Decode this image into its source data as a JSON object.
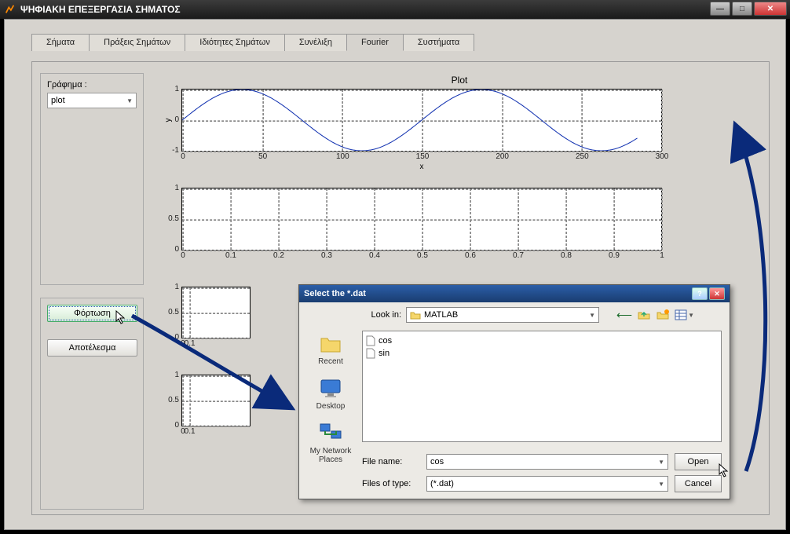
{
  "window": {
    "title": "ΨΗΦΙΑΚΗ ΕΠΕΞΕΡΓΑΣΙΑ ΣΗΜΑΤΟΣ"
  },
  "tabs": [
    {
      "label": "Σήματα",
      "active": false
    },
    {
      "label": "Πράξεις Σημάτων",
      "active": false
    },
    {
      "label": "Ιδιότητες Σημάτων",
      "active": false
    },
    {
      "label": "Συνέλιξη",
      "active": false
    },
    {
      "label": "Fourier",
      "active": true
    },
    {
      "label": "Συστήματα",
      "active": false
    }
  ],
  "sidebar": {
    "graph_label": "Γράφημα :",
    "graph_value": "plot",
    "load_btn": "Φόρτωση",
    "result_btn": "Αποτέλεσμα"
  },
  "chart_data": [
    {
      "type": "line",
      "title": "Plot",
      "xlabel": "x",
      "ylabel": "y",
      "xlim": [
        0,
        300
      ],
      "ylim": [
        -1,
        1
      ],
      "xticks": [
        0,
        50,
        100,
        150,
        200,
        250,
        300
      ],
      "yticks": [
        -1,
        0,
        1
      ],
      "function": "sin(2*pi*x/150)",
      "x": [
        0,
        25,
        50,
        75,
        100,
        125,
        150,
        175,
        200,
        225,
        250,
        275,
        300
      ],
      "y": [
        0,
        0.87,
        0.87,
        0,
        -0.87,
        -0.87,
        0,
        0.87,
        0.87,
        0,
        -0.87,
        -0.87,
        0
      ],
      "note": "Sine wave, period ≈150, amplitude 1. Curve drawn to x≈285."
    },
    {
      "type": "line",
      "title": "",
      "xlim": [
        0,
        1
      ],
      "ylim": [
        0,
        1
      ],
      "xticks": [
        0,
        0.1,
        0.2,
        0.3,
        0.4,
        0.5,
        0.6,
        0.7,
        0.8,
        0.9,
        1
      ],
      "yticks": [
        0,
        0.5,
        1
      ],
      "series": [],
      "note": "Empty axes (full width)."
    },
    {
      "type": "line",
      "xlim": [
        0,
        1
      ],
      "ylim": [
        0,
        1
      ],
      "xticks": [
        0,
        0.1
      ],
      "yticks": [
        0,
        0.5,
        1
      ],
      "series": [],
      "note": "Empty axes, left column (narrow, partially obscured by dialog)."
    },
    {
      "type": "line",
      "xlim": [
        0,
        1
      ],
      "ylim": [
        0,
        1
      ],
      "xticks": [
        0,
        0.1
      ],
      "yticks": [
        0,
        0.5,
        1
      ],
      "series": [],
      "note": "Empty axes, left column bottom (narrow, partially obscured by dialog)."
    }
  ],
  "dialog": {
    "title": "Select the *.dat",
    "lookin_label": "Look in:",
    "lookin_value": "MATLAB",
    "places": [
      "Recent",
      "Desktop",
      "My Network Places"
    ],
    "files": [
      "cos",
      "sin"
    ],
    "filename_label": "File name:",
    "filename_value": "cos",
    "filetype_label": "Files of type:",
    "filetype_value": "(*.dat)",
    "open_btn": "Open",
    "cancel_btn": "Cancel"
  }
}
